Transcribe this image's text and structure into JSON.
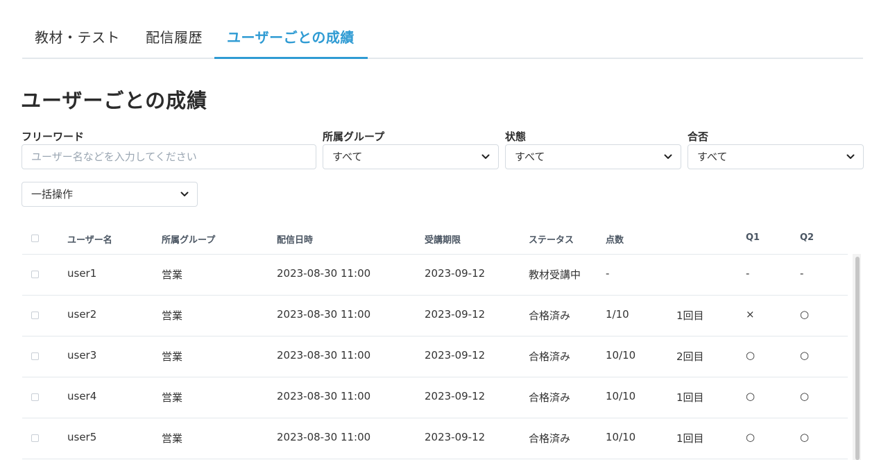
{
  "tabs": [
    {
      "label": "教材・テスト"
    },
    {
      "label": "配信履歴"
    },
    {
      "label": "ユーザーごとの成績"
    }
  ],
  "page_title": "ユーザーごとの成績",
  "filters": {
    "freeword_label": "フリーワード",
    "freeword_placeholder": "ユーザー名などを入力してください",
    "group_label": "所属グループ",
    "group_value": "すべて",
    "status_label": "状態",
    "status_value": "すべて",
    "pass_label": "合否",
    "pass_value": "すべて"
  },
  "bulk_action": "一括操作",
  "table": {
    "headers": [
      "ユーザー名",
      "所属グループ",
      "配信日時",
      "受講期限",
      "ステータス",
      "点数",
      "",
      "Q1",
      "Q2"
    ],
    "rows": [
      [
        "user1",
        "営業",
        "2023-08-30 11:00",
        "2023-09-12",
        "教材受講中",
        "-",
        "",
        "-",
        "-"
      ],
      [
        "user2",
        "営業",
        "2023-08-30 11:00",
        "2023-09-12",
        "合格済み",
        "1/10",
        "1回目",
        "×",
        "○"
      ],
      [
        "user3",
        "営業",
        "2023-08-30 11:00",
        "2023-09-12",
        "合格済み",
        "10/10",
        "2回目",
        "○",
        "○"
      ],
      [
        "user4",
        "営業",
        "2023-08-30 11:00",
        "2023-09-12",
        "合格済み",
        "10/10",
        "1回目",
        "○",
        "○"
      ],
      [
        "user5",
        "営業",
        "2023-08-30 11:00",
        "2023-09-12",
        "合格済み",
        "10/10",
        "1回目",
        "○",
        "○"
      ]
    ]
  },
  "colors": {
    "accent": "#2f9bd3",
    "border": "#d5dbe1",
    "divider": "#e3e8ec"
  },
  "icons": {
    "select_arrow": "chevron-down-icon",
    "row_select": "checkbox-icon"
  }
}
